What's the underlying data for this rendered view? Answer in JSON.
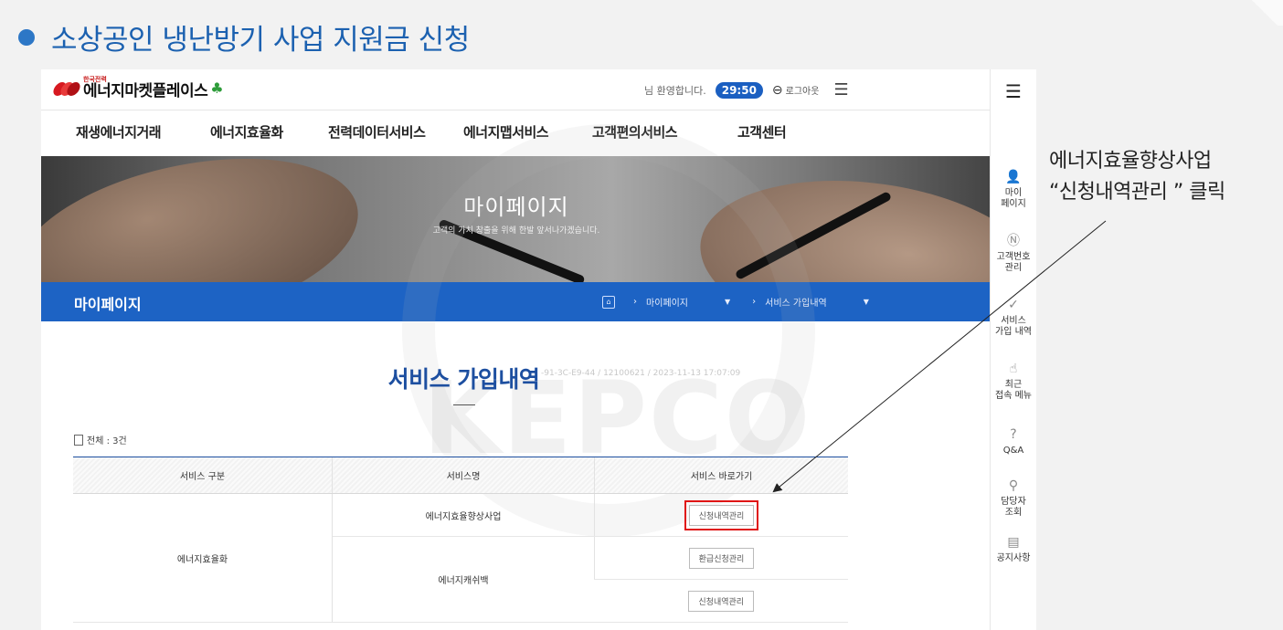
{
  "slide": {
    "title": "소상공인 냉난방기 사업 지원금 신청"
  },
  "annotation": {
    "line1": "에너지효율향상사업",
    "line2": "“신청내역관리 ” 클릭"
  },
  "site": {
    "logo_small": "한국전력",
    "logo_name": "에너지마켓플레이스",
    "welcome": "님 환영합니다.",
    "timer": "29:50",
    "logout": "로그아웃",
    "gnb": [
      "재생에너지거래",
      "에너지효율화",
      "전력데이터서비스",
      "에너지맵서비스",
      "고객편의서비스",
      "고객센터"
    ]
  },
  "hero": {
    "title": "마이페이지",
    "subtitle": "고객의 가치 창출을 위해 한발 앞서나가겠습니다."
  },
  "bluebar": {
    "title": "마이페이지",
    "crumb1": "마이페이지",
    "crumb2": "서비스 가입내역"
  },
  "watermark": "KEPCO",
  "page": {
    "title": "서비스 가입내역",
    "meta": "-91-3C-E9-44 / 12100621 / 2023-11-13 17:07:09",
    "total": "전체 : 3건"
  },
  "table": {
    "headers": [
      "서비스 구분",
      "서비스명",
      "서비스 바로가기"
    ],
    "category": "에너지효율화",
    "rows": [
      {
        "service": "에너지효율향상사업",
        "button": "신청내역관리"
      },
      {
        "service": "에너지캐쉬백",
        "button": "환급신청관리"
      },
      {
        "button": "신청내역관리"
      }
    ]
  },
  "rightnav": [
    {
      "icon": "user-icon",
      "label1": "마이",
      "label2": "페이지"
    },
    {
      "icon": "number-icon",
      "label1": "고객번호",
      "label2": "관리"
    },
    {
      "icon": "check-circle-icon",
      "label1": "서비스",
      "label2": "가입 내역"
    },
    {
      "icon": "pointer-icon",
      "label1": "최근",
      "label2": "접속 메뉴"
    },
    {
      "icon": "question-icon",
      "label1": "Q&A",
      "label2": ""
    },
    {
      "icon": "person-search-icon",
      "label1": "담당자",
      "label2": "조회"
    },
    {
      "icon": "notice-icon",
      "label1": "공지사항",
      "label2": ""
    }
  ]
}
